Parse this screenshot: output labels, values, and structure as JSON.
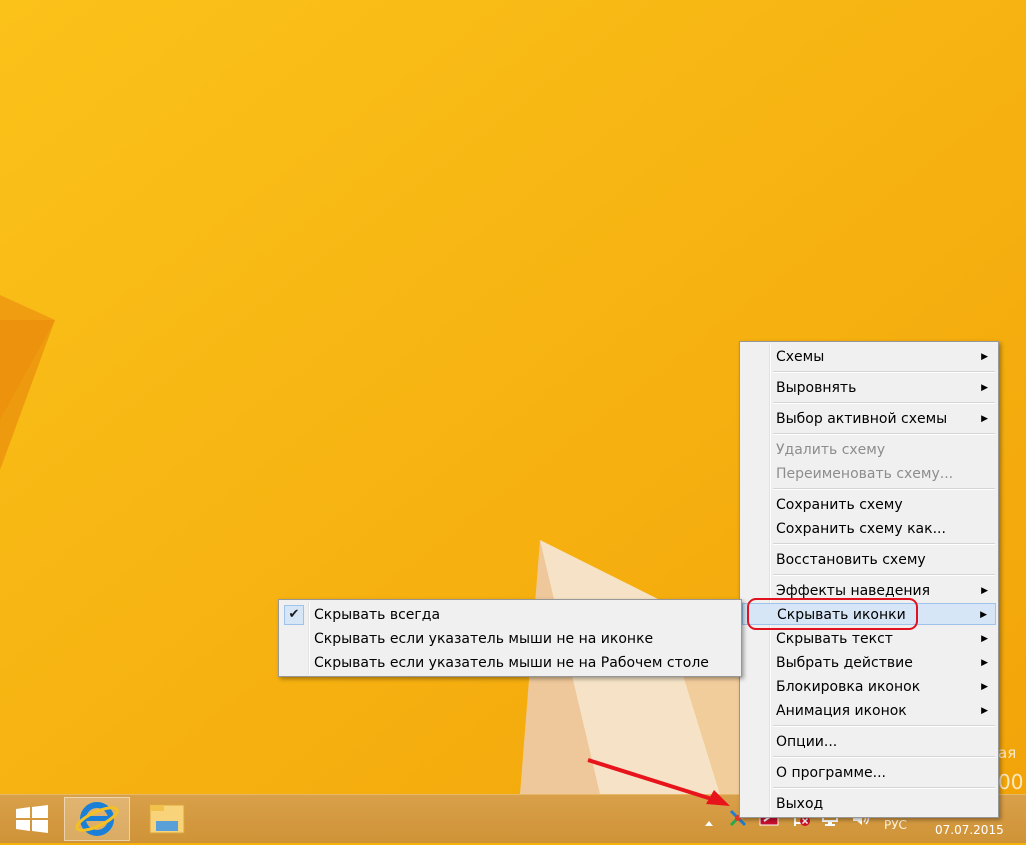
{
  "context_menu": {
    "items": [
      {
        "label": "Схемы",
        "submenu": true,
        "enabled": true
      },
      {
        "label": "Выровнять",
        "submenu": true,
        "enabled": true
      },
      {
        "label": "Выбор активной схемы",
        "submenu": true,
        "enabled": true
      },
      {
        "label": "Удалить схему",
        "submenu": false,
        "enabled": false
      },
      {
        "label": "Переименовать схему...",
        "submenu": false,
        "enabled": false
      },
      {
        "label": "Сохранить схему",
        "submenu": false,
        "enabled": true
      },
      {
        "label": "Сохранить схему как...",
        "submenu": false,
        "enabled": true
      },
      {
        "label": "Восстановить схему",
        "submenu": false,
        "enabled": true
      },
      {
        "label": "Эффекты наведения",
        "submenu": true,
        "enabled": true
      },
      {
        "label": "Скрывать иконки",
        "submenu": true,
        "enabled": true,
        "active": true
      },
      {
        "label": "Скрывать текст",
        "submenu": true,
        "enabled": true
      },
      {
        "label": "Выбрать действие",
        "submenu": true,
        "enabled": true
      },
      {
        "label": "Блокировка иконок",
        "submenu": true,
        "enabled": true
      },
      {
        "label": "Анимация иконок",
        "submenu": true,
        "enabled": true
      },
      {
        "label": "Опции...",
        "submenu": false,
        "enabled": true
      },
      {
        "label": "О программе...",
        "submenu": false,
        "enabled": true
      },
      {
        "label": "Выход",
        "submenu": false,
        "enabled": true
      }
    ],
    "arrow_glyph": "▶"
  },
  "submenu": {
    "items": [
      {
        "label": "Скрывать всегда",
        "checked": true
      },
      {
        "label": "Скрывать если указатель мыши не на иконке",
        "checked": false
      },
      {
        "label": "Скрывать если указатель мыши не на Рабочем столе",
        "checked": false
      }
    ],
    "check_glyph": "✔"
  },
  "taskbar": {
    "pinned": [
      "windows-start-icon",
      "internet-explorer-icon",
      "file-explorer-icon"
    ],
    "tray_icons": [
      "show-hidden-icons-chevron",
      "fences-app-icon",
      "action-center-flag-icon",
      "network-icon",
      "speaker-icon"
    ],
    "language": "РУС",
    "date": "07.07.2015",
    "partial_desktop_text": "ая",
    "partial_time_text": "00"
  },
  "colors": {
    "desktop": "#f7b10c",
    "highlight_ring": "#e0121f",
    "annotation_arrow": "#e8141c",
    "menu_bg": "#f0f0f0",
    "menu_active": "#d7e6f7"
  }
}
